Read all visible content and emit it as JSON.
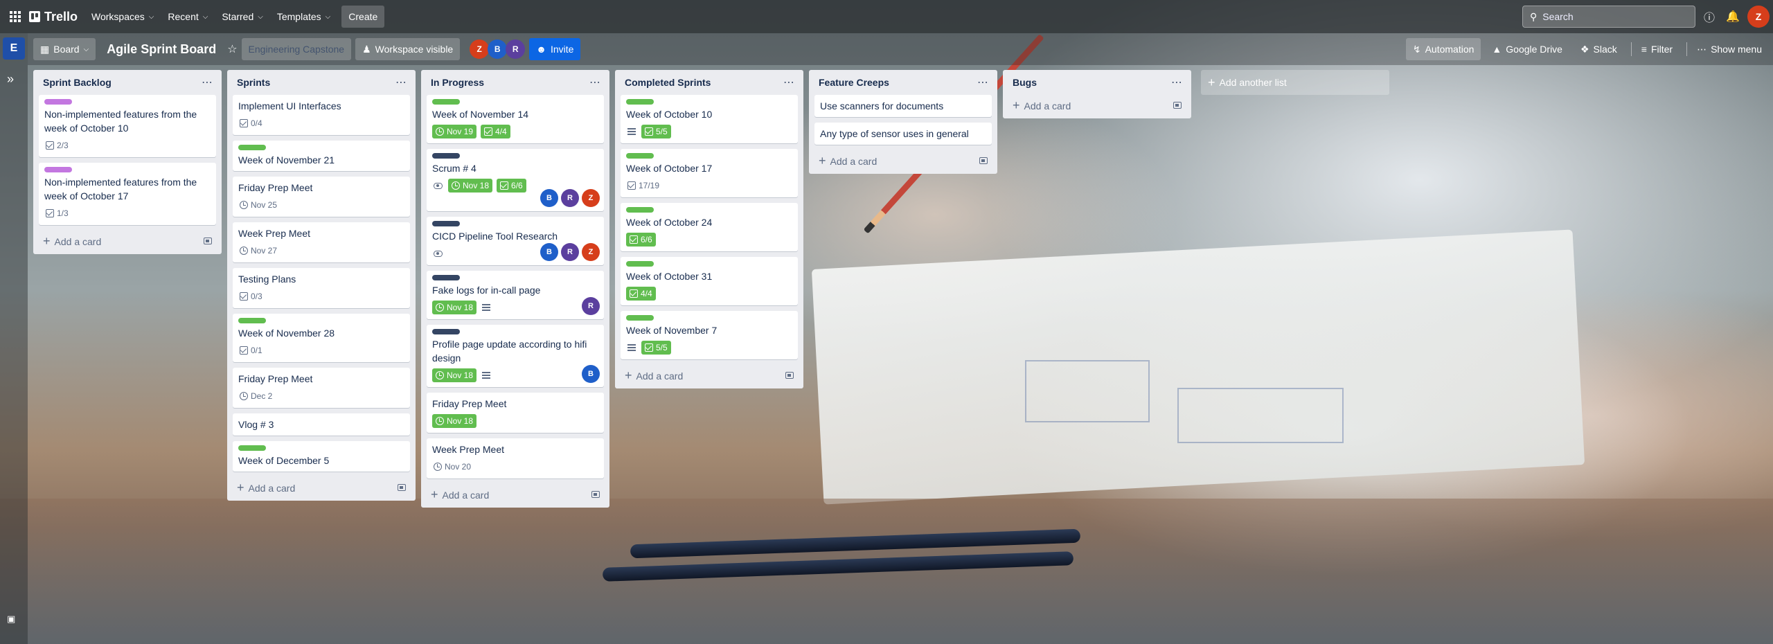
{
  "header": {
    "app_name": "Trello",
    "nav": [
      {
        "label": "Workspaces"
      },
      {
        "label": "Recent"
      },
      {
        "label": "Starred"
      },
      {
        "label": "Templates"
      }
    ],
    "create_label": "Create",
    "search_placeholder": "Search",
    "user_initial": "Z"
  },
  "rail": {
    "workspace_initial": "E"
  },
  "board": {
    "view_label": "Board",
    "title": "Agile Sprint Board",
    "workspace_name": "Engineering Capstone",
    "visibility_label": "Workspace visible",
    "members": [
      "Z",
      "B",
      "R"
    ],
    "invite_label": "Invite",
    "automation_label": "Automation",
    "drive_label": "Google Drive",
    "slack_label": "Slack",
    "filter_label": "Filter",
    "menu_label": "Show menu",
    "add_card_label": "Add a card",
    "add_list_label": "Add another list"
  },
  "lists": [
    {
      "title": "Sprint Backlog",
      "cards": [
        {
          "title": "Non-implemented features from the week of October 10",
          "label": "pink",
          "checklist": "2/3"
        },
        {
          "title": "Non-implemented features from the week of October 17",
          "label": "pink",
          "checklist": "1/3"
        }
      ]
    },
    {
      "title": "Sprints",
      "cards": [
        {
          "title": "Implement UI Interfaces",
          "checklist": "0/4"
        },
        {
          "title": "Week of November 21",
          "label": "green"
        },
        {
          "title": "Friday Prep Meet",
          "due": "Nov 25"
        },
        {
          "title": "Week Prep Meet",
          "due": "Nov 27"
        },
        {
          "title": "Testing Plans",
          "checklist": "0/3"
        },
        {
          "title": "Week of November 28",
          "label": "green",
          "checklist": "0/1"
        },
        {
          "title": "Friday Prep Meet",
          "due": "Dec 2"
        },
        {
          "title": "Vlog # 3"
        },
        {
          "title": "Week of December 5",
          "label": "green"
        }
      ]
    },
    {
      "title": "In Progress",
      "cards": [
        {
          "title": "Week of November 14",
          "label": "green",
          "due": "Nov 19",
          "due_done": true,
          "checklist": "4/4",
          "checklist_done": true
        },
        {
          "title": "Scrum # 4",
          "label": "navy",
          "watch": true,
          "due": "Nov 18",
          "due_done": true,
          "checklist": "6/6",
          "checklist_done": true,
          "members": [
            "B",
            "R",
            "Z"
          ]
        },
        {
          "title": "CICD Pipeline Tool Research",
          "label": "navy",
          "watch": true,
          "members": [
            "B",
            "R",
            "Z"
          ]
        },
        {
          "title": "Fake logs for in-call page",
          "label": "navy",
          "due": "Nov 18",
          "due_done": true,
          "description": true,
          "members": [
            "R"
          ]
        },
        {
          "title": "Profile page update according to hifi design",
          "label": "navy",
          "due": "Nov 18",
          "due_done": true,
          "description": true,
          "members": [
            "B"
          ]
        },
        {
          "title": "Friday Prep Meet",
          "due": "Nov 18",
          "due_done": true
        },
        {
          "title": "Week Prep Meet",
          "due": "Nov 20"
        }
      ]
    },
    {
      "title": "Completed Sprints",
      "cards": [
        {
          "title": "Week of October 10",
          "label": "green",
          "description": true,
          "checklist": "5/5",
          "checklist_done": true
        },
        {
          "title": "Week of October 17",
          "label": "green",
          "checklist": "17/19"
        },
        {
          "title": "Week of October 24",
          "label": "green",
          "checklist": "6/6",
          "checklist_done": true
        },
        {
          "title": "Week of October 31",
          "label": "green",
          "checklist": "4/4",
          "checklist_done": true
        },
        {
          "title": "Week of November 7",
          "label": "green",
          "description": true,
          "checklist": "5/5",
          "checklist_done": true
        }
      ]
    },
    {
      "title": "Feature Creeps",
      "cards": [
        {
          "title": "Use scanners for documents"
        },
        {
          "title": "Any type of sensor uses in general"
        }
      ]
    },
    {
      "title": "Bugs",
      "cards": []
    }
  ]
}
